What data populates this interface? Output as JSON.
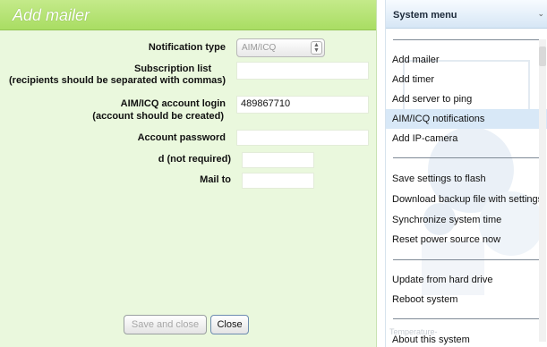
{
  "dialog": {
    "title": "Add mailer",
    "fields": {
      "notification_type": {
        "label": "Notification type",
        "value": "AIM/ICQ"
      },
      "subscription_list": {
        "label": "Subscription list",
        "sublabel": "(recipients should be separated with commas)",
        "value": ""
      },
      "account_login": {
        "label": "AIM/ICQ account login",
        "sublabel": "(account should be created)",
        "value": "489867710"
      },
      "account_password": {
        "label": "Account password",
        "value": ""
      },
      "id_not_required": {
        "label": "d (not required)",
        "value": ""
      },
      "mail_to": {
        "label": "Mail to",
        "value": ""
      }
    },
    "buttons": {
      "save_close": "Save and close",
      "close": "Close"
    }
  },
  "menu": {
    "title": "System menu",
    "groups": [
      [
        "Add mailer",
        "Add timer",
        "Add server to ping",
        "AIM/ICQ notifications",
        "Add IP-camera"
      ],
      [
        "Save settings to flash",
        "Download backup file with settings",
        "Synchronize system time",
        "Reset power source now"
      ],
      [
        "Update from hard drive",
        "Reboot system"
      ],
      [
        "About this system"
      ]
    ],
    "active_item": "AIM/ICQ notifications",
    "faint_text": "Temperature-"
  },
  "colors": {
    "dialog_title_bg": "#a9dd63",
    "dialog_bg": "#eaf8dd",
    "menu_active_bg": "#d8e8f7"
  }
}
